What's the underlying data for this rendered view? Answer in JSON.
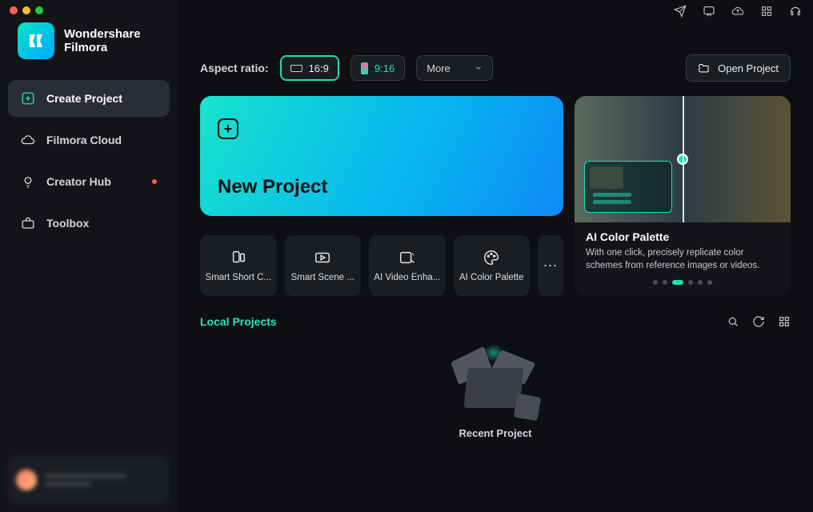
{
  "brand": {
    "line1": "Wondershare",
    "line2": "Filmora"
  },
  "sidebar": {
    "items": [
      {
        "label": "Create Project"
      },
      {
        "label": "Filmora Cloud"
      },
      {
        "label": "Creator Hub"
      },
      {
        "label": "Toolbox"
      }
    ]
  },
  "aspect": {
    "label": "Aspect ratio:",
    "r169": "16:9",
    "r916": "9:16",
    "more": "More"
  },
  "open_project": "Open Project",
  "new_project": {
    "title": "New Project"
  },
  "feature": {
    "title": "AI Color Palette",
    "desc": "With one click, precisely replicate color schemes from reference images or videos.",
    "active_index": 2,
    "dot_count": 6
  },
  "tools": [
    {
      "label": "Smart Short C..."
    },
    {
      "label": "Smart Scene ..."
    },
    {
      "label": "AI Video Enha..."
    },
    {
      "label": "AI Color Palette"
    }
  ],
  "local": {
    "title": "Local Projects",
    "empty": "Recent Project"
  }
}
